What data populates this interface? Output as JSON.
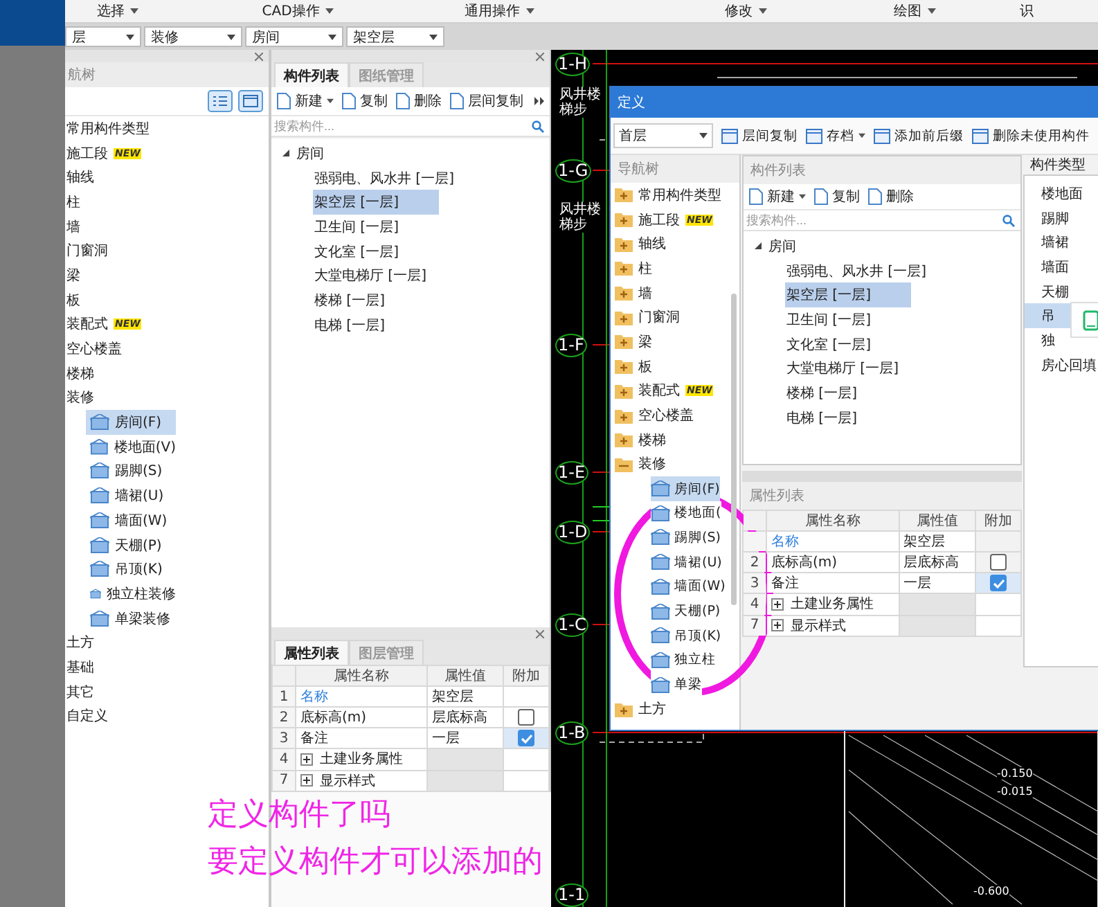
{
  "top_bar": {
    "menus": [
      {
        "label": "选择"
      },
      {
        "label": "CAD操作"
      },
      {
        "label": "通用操作"
      },
      {
        "label": "修改"
      },
      {
        "label": "绘图"
      },
      {
        "label": "识"
      }
    ],
    "selectors": [
      "层",
      "装修",
      "房间",
      "架空层"
    ]
  },
  "nav_panel": {
    "title": "航树",
    "items": [
      {
        "label": "常用构件类型"
      },
      {
        "label": "施工段",
        "badge": "NEW"
      },
      {
        "label": "轴线"
      },
      {
        "label": "柱"
      },
      {
        "label": "墙"
      },
      {
        "label": "门窗洞"
      },
      {
        "label": "梁"
      },
      {
        "label": "板"
      },
      {
        "label": "装配式",
        "badge": "NEW"
      },
      {
        "label": "空心楼盖"
      },
      {
        "label": "楼梯"
      },
      {
        "label": "装修",
        "children": [
          {
            "label": "房间(F)",
            "selected": true
          },
          {
            "label": "楼地面(V)",
            "selected": false
          },
          {
            "label": "踢脚(S)",
            "selected": false
          },
          {
            "label": "墙裙(U)",
            "selected": false
          },
          {
            "label": "墙面(W)",
            "selected": false
          },
          {
            "label": "天棚(P)",
            "selected": false
          },
          {
            "label": "吊顶(K)",
            "selected": false
          },
          {
            "label": "独立柱装修",
            "selected": false
          },
          {
            "label": "单梁装修",
            "selected": false
          }
        ]
      },
      {
        "label": "土方"
      },
      {
        "label": "基础"
      },
      {
        "label": "其它"
      },
      {
        "label": "自定义"
      }
    ]
  },
  "component_list": {
    "tabs": [
      {
        "label": "构件列表",
        "selected": true
      },
      {
        "label": "图纸管理",
        "selected": false
      }
    ],
    "toolbar": [
      {
        "label": "新建",
        "dropdown": true
      },
      {
        "label": "复制",
        "dropdown": false
      },
      {
        "label": "删除",
        "dropdown": false
      },
      {
        "label": "层间复制",
        "dropdown": false
      }
    ],
    "search": {
      "placeholder": "搜索构件..."
    },
    "tree": {
      "label": "房间",
      "expanded": true,
      "children": [
        {
          "label": "强弱电、风水井 [一层]",
          "selected": false
        },
        {
          "label": "架空层 [一层]",
          "selected": true
        },
        {
          "label": "卫生间 [一层]",
          "selected": false
        },
        {
          "label": "文化室 [一层]",
          "selected": false
        },
        {
          "label": "大堂电梯厅 [一层]",
          "selected": false
        },
        {
          "label": "楼梯 [一层]",
          "selected": false
        },
        {
          "label": "电梯 [一层]",
          "selected": false
        }
      ]
    }
  },
  "properties": {
    "tabs": [
      {
        "label": "属性列表",
        "selected": true
      },
      {
        "label": "图层管理",
        "selected": false
      }
    ],
    "columns": [
      "属性名称",
      "属性值",
      "附加"
    ],
    "rows": [
      {
        "num": "1",
        "kind": "name",
        "name": "名称",
        "value": "架空层"
      },
      {
        "num": "2",
        "kind": "field",
        "name": "底标高(m)",
        "value": "层底标高",
        "checked": false
      },
      {
        "num": "3",
        "kind": "field",
        "name": "备注",
        "value": "一层",
        "checked": true
      },
      {
        "num": "4",
        "kind": "group",
        "name": "土建业务属性"
      },
      {
        "num": "7",
        "kind": "group",
        "name": "显示样式"
      }
    ]
  },
  "dialog": {
    "title": "定义",
    "floor": "首层",
    "toolbar": [
      {
        "label": "层间复制",
        "dropdown": false
      },
      {
        "label": "存档",
        "dropdown": true
      },
      {
        "label": "添加前后缀",
        "dropdown": false
      },
      {
        "label": "删除未使用构件",
        "dropdown": false
      }
    ],
    "nav": {
      "title": "导航树",
      "items": [
        {
          "label": "常用构件类型",
          "expanded": false
        },
        {
          "label": "施工段",
          "badge": "NEW",
          "expanded": false
        },
        {
          "label": "轴线",
          "expanded": false
        },
        {
          "label": "柱",
          "expanded": false
        },
        {
          "label": "墙",
          "expanded": false
        },
        {
          "label": "门窗洞",
          "expanded": false
        },
        {
          "label": "梁",
          "expanded": false
        },
        {
          "label": "板",
          "expanded": false
        },
        {
          "label": "装配式",
          "badge": "NEW",
          "expanded": false
        },
        {
          "label": "空心楼盖",
          "expanded": false
        },
        {
          "label": "楼梯",
          "expanded": false
        },
        {
          "label": "装修",
          "expanded": true,
          "children": [
            {
              "label": "房间(F)",
              "selected": true
            },
            {
              "label": "楼地面(",
              "selected": false
            },
            {
              "label": "踢脚(S)",
              "selected": false
            },
            {
              "label": "墙裙(U)",
              "selected": false
            },
            {
              "label": "墙面(W)",
              "selected": false
            },
            {
              "label": "天棚(P)",
              "selected": false
            },
            {
              "label": "吊顶(K)",
              "selected": false
            },
            {
              "label": "独立柱",
              "selected": false
            },
            {
              "label": "单梁",
              "selected": false
            }
          ]
        },
        {
          "label": "土方",
          "expanded": false
        }
      ]
    },
    "list": {
      "title": "构件列表",
      "toolbar": [
        {
          "label": "新建",
          "dropdown": true
        },
        {
          "label": "复制",
          "dropdown": false
        },
        {
          "label": "删除",
          "dropdown": false
        }
      ],
      "search": {
        "placeholder": "搜索构件..."
      },
      "tree": {
        "label": "房间",
        "expanded": true,
        "children": [
          {
            "label": "强弱电、风水井 [一层]",
            "selected": false
          },
          {
            "label": "架空层 [一层]",
            "selected": true
          },
          {
            "label": "卫生间 [一层]",
            "selected": false
          },
          {
            "label": "文化室 [一层]",
            "selected": false
          },
          {
            "label": "大堂电梯厅 [一层]",
            "selected": false
          },
          {
            "label": "楼梯 [一层]",
            "selected": false
          },
          {
            "label": "电梯 [一层]",
            "selected": false
          }
        ]
      }
    },
    "properties": {
      "title": "属性列表",
      "columns": [
        "属性名称",
        "属性值",
        "附加"
      ],
      "rows": [
        {
          "kind": "name",
          "name": "名称",
          "value": "架空层"
        },
        {
          "num": "2",
          "kind": "field",
          "name": "底标高(m)",
          "value": "层底标高",
          "checked": false
        },
        {
          "num": "3",
          "kind": "field",
          "name": "备注",
          "value": "一层",
          "checked": true
        },
        {
          "num": "4",
          "kind": "group",
          "name": "土建业务属性"
        },
        {
          "num": "7",
          "kind": "group",
          "name": "显示样式"
        }
      ]
    },
    "types": {
      "title": "构件类型",
      "items": [
        {
          "label": "楼地面",
          "selected": false
        },
        {
          "label": "踢脚",
          "selected": false
        },
        {
          "label": "墙裙",
          "selected": false
        },
        {
          "label": "墙面",
          "selected": false
        },
        {
          "label": "天棚",
          "selected": false
        },
        {
          "label": "吊",
          "selected": true
        },
        {
          "label": "独",
          "selected": false
        },
        {
          "label": "房心回填",
          "selected": false
        }
      ]
    }
  },
  "cad": {
    "axes": [
      "1-H",
      "1-G",
      "1-F",
      "1-E",
      "1-D",
      "1-C",
      "1-B",
      "1-1"
    ],
    "notes": [
      "风井楼梯步",
      "风井楼梯步"
    ],
    "levels": [
      "-0.150",
      "-0.015",
      "-0.600"
    ]
  },
  "annotation": {
    "lines": [
      "定义构件了吗",
      "要定义构件才可以添加的"
    ]
  }
}
